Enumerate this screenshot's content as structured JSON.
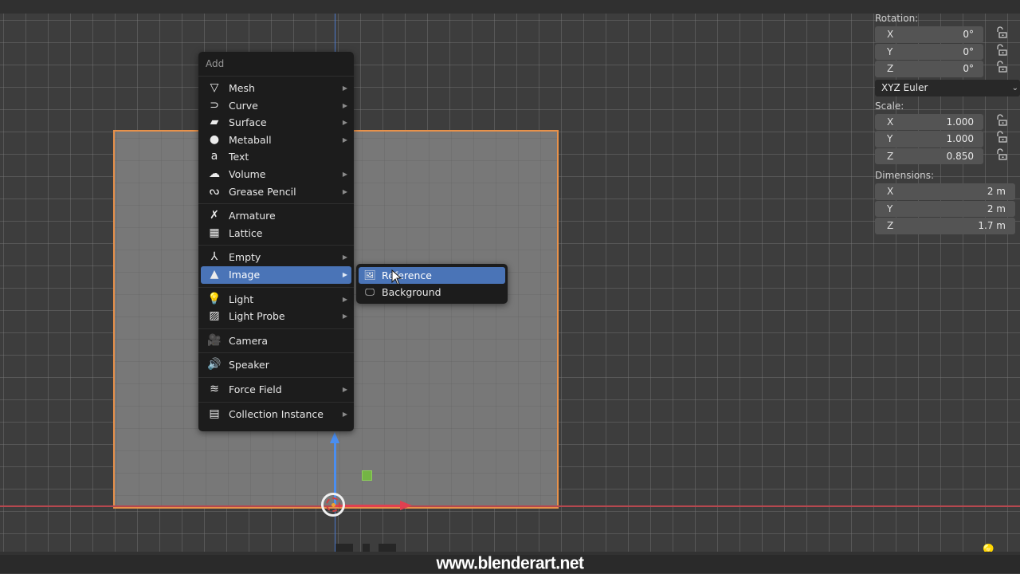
{
  "watermark": "www.blenderart.net",
  "add_menu": {
    "title": "Add",
    "groups": [
      [
        {
          "label": "Mesh",
          "icon": "mesh-icon",
          "glyph": "▽",
          "submenu": true
        },
        {
          "label": "Curve",
          "icon": "curve-icon",
          "glyph": "⊃",
          "submenu": true
        },
        {
          "label": "Surface",
          "icon": "surface-icon",
          "glyph": "▰",
          "submenu": true
        },
        {
          "label": "Metaball",
          "icon": "metaball-icon",
          "glyph": "●",
          "submenu": true
        },
        {
          "label": "Text",
          "icon": "text-icon",
          "glyph": "a",
          "submenu": false
        },
        {
          "label": "Volume",
          "icon": "volume-icon",
          "glyph": "☁",
          "submenu": true
        },
        {
          "label": "Grease Pencil",
          "icon": "grease-pencil-icon",
          "glyph": "ᔓ",
          "submenu": true
        }
      ],
      [
        {
          "label": "Armature",
          "icon": "armature-icon",
          "glyph": "✗",
          "submenu": false
        },
        {
          "label": "Lattice",
          "icon": "lattice-icon",
          "glyph": "▦",
          "submenu": false
        }
      ],
      [
        {
          "label": "Empty",
          "icon": "empty-icon",
          "glyph": "⅄",
          "submenu": true
        },
        {
          "label": "Image",
          "icon": "image-icon",
          "glyph": "▲",
          "submenu": true,
          "active": true
        }
      ],
      [
        {
          "label": "Light",
          "icon": "light-icon",
          "glyph": "💡",
          "submenu": true
        },
        {
          "label": "Light Probe",
          "icon": "light-probe-icon",
          "glyph": "▨",
          "submenu": true
        }
      ],
      [
        {
          "label": "Camera",
          "icon": "camera-icon",
          "glyph": "🎥",
          "submenu": false
        }
      ],
      [
        {
          "label": "Speaker",
          "icon": "speaker-icon",
          "glyph": "🔊",
          "submenu": false
        }
      ],
      [
        {
          "label": "Force Field",
          "icon": "force-field-icon",
          "glyph": "≋",
          "submenu": true
        }
      ],
      [
        {
          "label": "Collection Instance",
          "icon": "collection-instance-icon",
          "glyph": "▤",
          "submenu": true
        }
      ]
    ]
  },
  "image_submenu": {
    "items": [
      {
        "label": "Reference",
        "icon": "reference-image-icon",
        "glyph": "🖼",
        "active": true
      },
      {
        "label": "Background",
        "icon": "background-image-icon",
        "glyph": "🖵",
        "active": false
      }
    ]
  },
  "properties": {
    "rotation": {
      "label": "Rotation:",
      "fields": [
        {
          "axis": "X",
          "value": "0°"
        },
        {
          "axis": "Y",
          "value": "0°"
        },
        {
          "axis": "Z",
          "value": "0°"
        }
      ],
      "mode": "XYZ Euler"
    },
    "scale": {
      "label": "Scale:",
      "fields": [
        {
          "axis": "X",
          "value": "1.000"
        },
        {
          "axis": "Y",
          "value": "1.000"
        },
        {
          "axis": "Z",
          "value": "0.850"
        }
      ]
    },
    "dimensions": {
      "label": "Dimensions:",
      "fields": [
        {
          "axis": "X",
          "value": "2 m"
        },
        {
          "axis": "Y",
          "value": "2 m"
        },
        {
          "axis": "Z",
          "value": "1.7 m"
        }
      ]
    }
  },
  "colors": {
    "accent": "#4a74b7",
    "selection_outline": "#e8914a",
    "x_axis": "#e04050",
    "z_axis": "#4a8ef0"
  }
}
